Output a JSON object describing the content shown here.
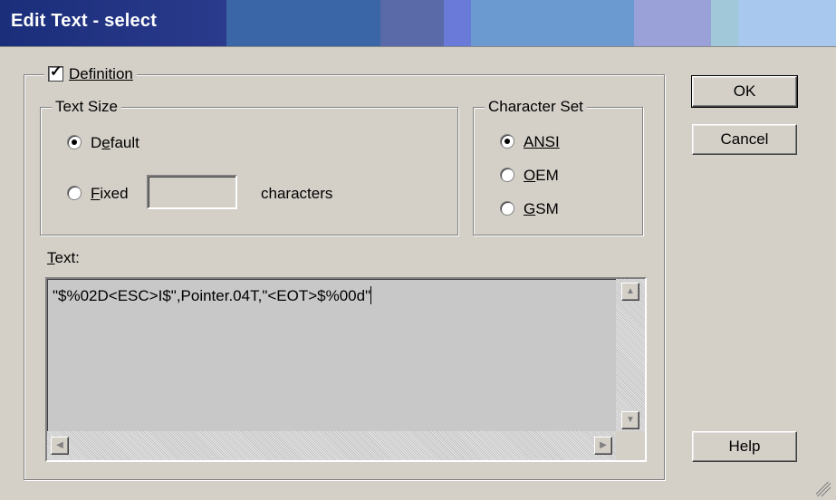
{
  "window": {
    "title": "Edit Text - select"
  },
  "definition": {
    "label": "Definition",
    "checked": true
  },
  "text_size": {
    "label": "Text Size",
    "default_label": "Default",
    "fixed_label": "Fixed",
    "fixed_value": "",
    "characters_label": "characters",
    "selected": "Default"
  },
  "character_set": {
    "label": "Character Set",
    "options": [
      "ANSI",
      "OEM",
      "GSM"
    ],
    "selected": "ANSI"
  },
  "text": {
    "label": "Text:",
    "value": "\"$%02D<ESC>I$\",Pointer.04T,\"<EOT>$%00d\""
  },
  "buttons": {
    "ok": "OK",
    "cancel": "Cancel",
    "help": "Help"
  }
}
